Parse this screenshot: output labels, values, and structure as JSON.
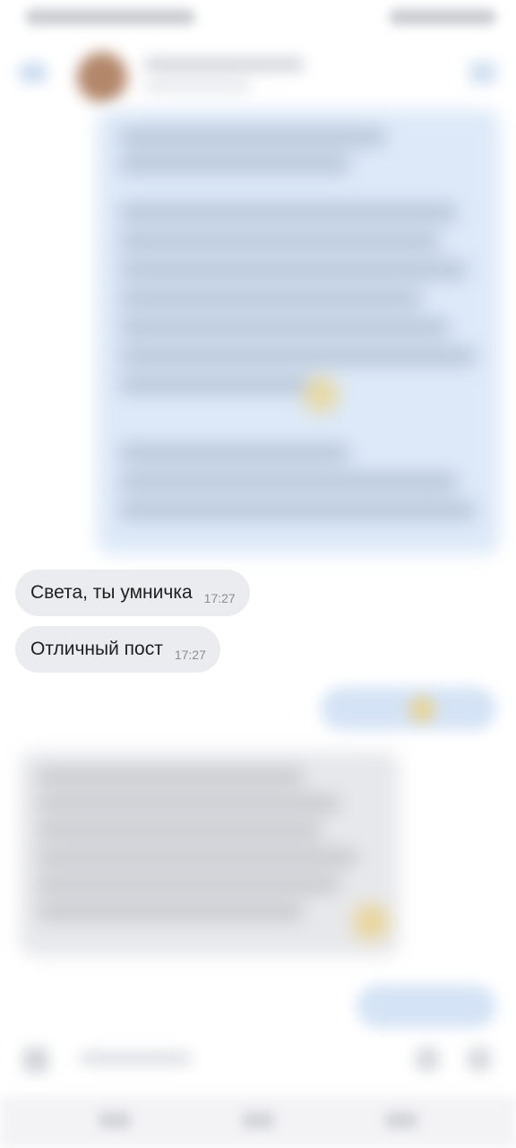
{
  "chat": {
    "messages": [
      {
        "text": "Света, ты умничка",
        "time": "17:27"
      },
      {
        "text": "Отличный пост",
        "time": "17:27"
      }
    ]
  },
  "colors": {
    "incoming_bubble": "#ebecef",
    "outgoing_bubble": "#d4e3f5",
    "post_card": "#dde9f8",
    "timestamp": "#8a8d92"
  },
  "icons": {
    "back": "back-arrow-icon",
    "menu": "menu-icon",
    "attach": "attach-icon",
    "emoji": "emoji-icon",
    "send": "send-icon"
  }
}
